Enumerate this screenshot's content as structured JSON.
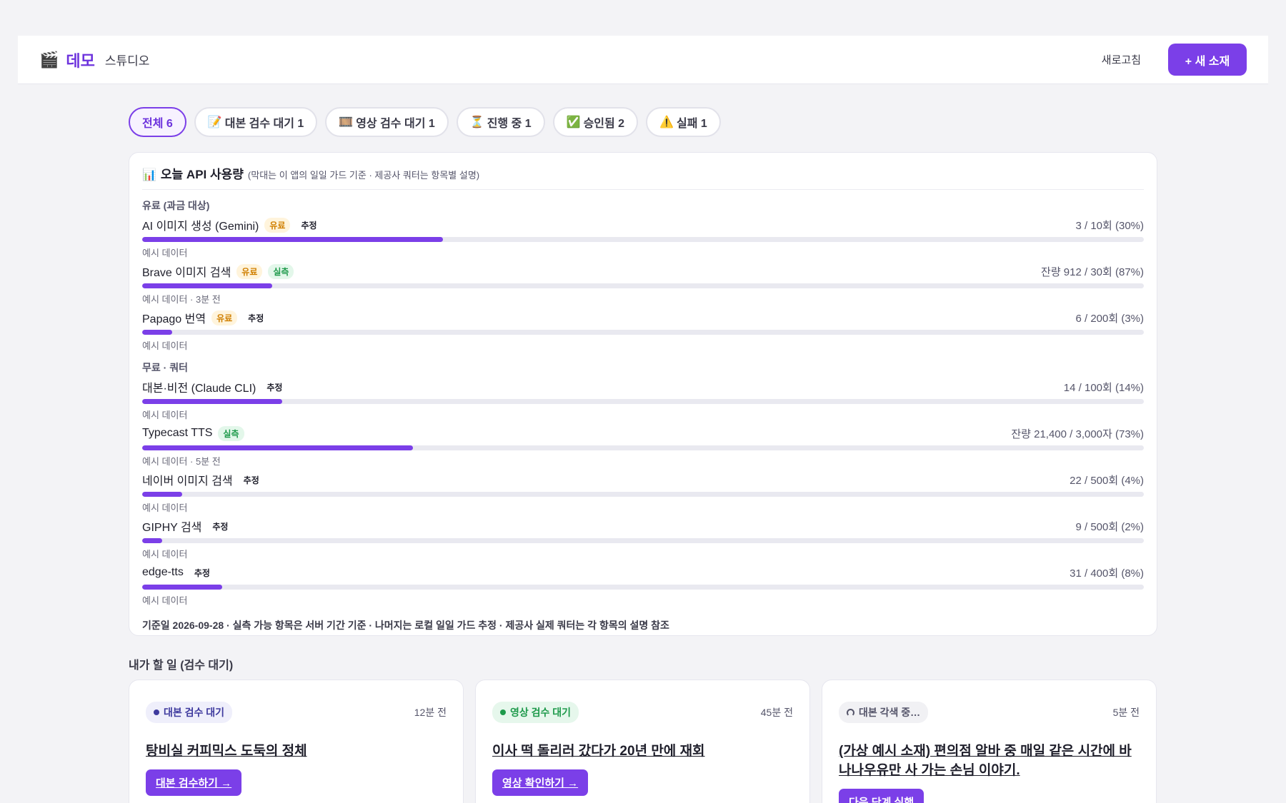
{
  "header": {
    "brand_icon": "🎬",
    "brand_name": "데모",
    "brand_sub": "스튜디오",
    "refresh_label": "새로고침",
    "new_label": "+ 새 소재"
  },
  "tabs": [
    {
      "label": "전체 6",
      "icon": ""
    },
    {
      "label": "대본 검수 대기 1",
      "icon": "📝"
    },
    {
      "label": "영상 검수 대기 1",
      "icon": "🎞️"
    },
    {
      "label": "진행 중 1",
      "icon": "⏳"
    },
    {
      "label": "승인됨 2",
      "icon": "✅"
    },
    {
      "label": "실패 1",
      "icon": "⚠️"
    }
  ],
  "usage": {
    "icon": "📊",
    "title": "오늘 API 사용량",
    "note": "(막대는 이 앱의 일일 가드 기준 · 제공사 쿼터는 항목별 설명)",
    "paid_group": "유료 (과금 대상)",
    "free_group": "무료 · 쿼터",
    "paid_rows": [
      {
        "name": "AI 이미지 생성 (Gemini)",
        "badges": [
          {
            "t": "유료",
            "k": "paid"
          },
          {
            "t": "추정",
            "k": "est"
          }
        ],
        "value": "3 / 10회 (30%)",
        "fill": 0.3,
        "meta": "예시 데이터"
      },
      {
        "name": "Brave 이미지 검색",
        "badges": [
          {
            "t": "유료",
            "k": "paid"
          },
          {
            "t": "실측",
            "k": "meas"
          }
        ],
        "value": "잔량 912 / 30회 (87%)",
        "fill": 0.13,
        "meta": "예시 데이터 · 3분 전"
      },
      {
        "name": "Papago 번역",
        "badges": [
          {
            "t": "유료",
            "k": "paid"
          },
          {
            "t": "추정",
            "k": "est"
          }
        ],
        "value": "6 / 200회 (3%)",
        "fill": 0.03,
        "meta": "예시 데이터"
      }
    ],
    "free_rows": [
      {
        "name": "대본·비전 (Claude CLI)",
        "badges": [
          {
            "t": "추정",
            "k": "est"
          }
        ],
        "value": "14 / 100회 (14%)",
        "fill": 0.14,
        "meta": "예시 데이터"
      },
      {
        "name": "Typecast TTS",
        "badges": [
          {
            "t": "실측",
            "k": "meas"
          }
        ],
        "value": "잔량 21,400 / 3,000자 (73%)",
        "fill": 0.27,
        "meta": "예시 데이터 · 5분 전"
      },
      {
        "name": "네이버 이미지 검색",
        "badges": [
          {
            "t": "추정",
            "k": "est"
          }
        ],
        "value": "22 / 500회 (4%)",
        "fill": 0.04,
        "meta": "예시 데이터"
      },
      {
        "name": "GIPHY 검색",
        "badges": [
          {
            "t": "추정",
            "k": "est"
          }
        ],
        "value": "9 / 500회 (2%)",
        "fill": 0.02,
        "meta": "예시 데이터"
      },
      {
        "name": "edge-tts",
        "badges": [
          {
            "t": "추정",
            "k": "est"
          }
        ],
        "value": "31 / 400회 (8%)",
        "fill": 0.08,
        "meta": "예시 데이터"
      }
    ],
    "footer": "기준일 2026-09-28 · 실측 가능 항목은 서버 기간 기준 · 나머지는 로컬 일일 가드 추정 · 제공사 실제 쿼터는 각 항목의 설명 참조"
  },
  "todo": {
    "title": "내가 할 일 (검수 대기)",
    "cards": [
      {
        "status": "대본 검수 대기",
        "kind": "script",
        "time": "12분 전",
        "title": "탕비실 커피믹스 도둑의 정체",
        "action": "대본 검수하기 →"
      },
      {
        "status": "영상 검수 대기",
        "kind": "video",
        "time": "45분 전",
        "title": "이사 떡 돌리러 갔다가 20년 만에 재회",
        "action": "영상 확인하기 →"
      },
      {
        "status": "대본 각색 중…",
        "kind": "working",
        "time": "5분 전",
        "title": "(가상 예시 소재) 편의점 알바 중 매일 같은 시간에 바나나우유만 사 가는 손님 이야기.",
        "action": "다음 단계 실행"
      }
    ]
  }
}
